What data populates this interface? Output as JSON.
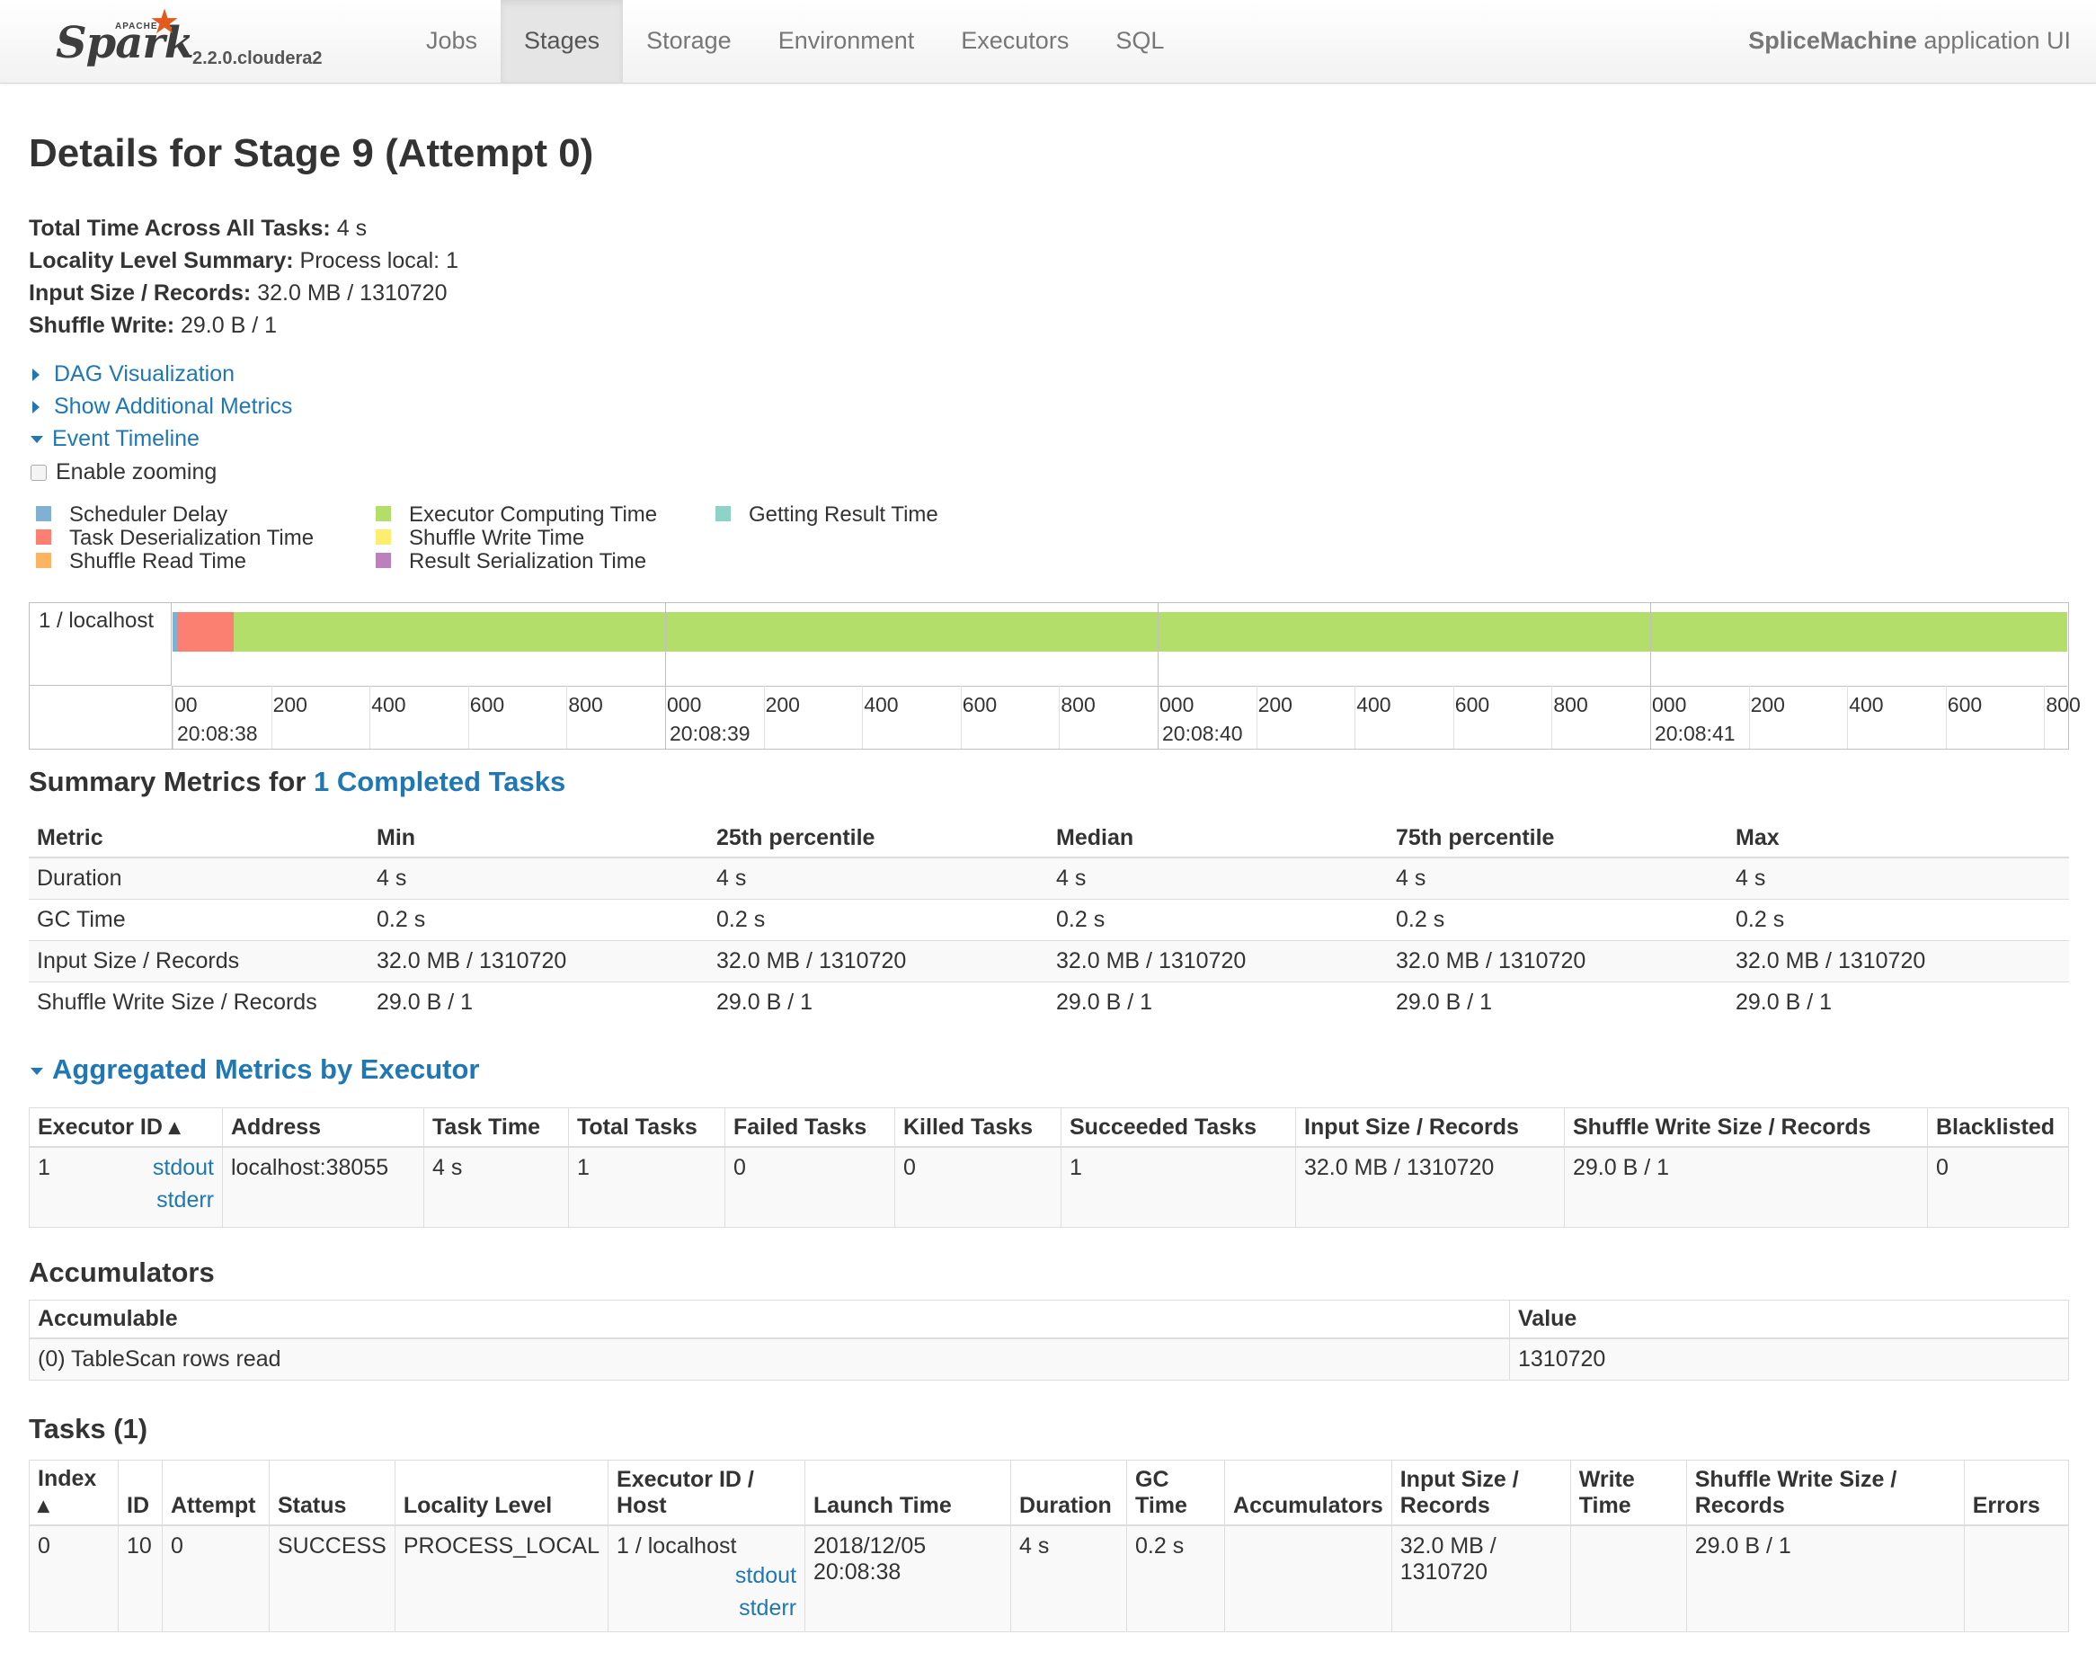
{
  "navbar": {
    "logo_apache": "APACHE",
    "logo_spark": "Spark",
    "version": "2.2.0.cloudera2",
    "tabs": [
      {
        "label": "Jobs",
        "active": false
      },
      {
        "label": "Stages",
        "active": true
      },
      {
        "label": "Storage",
        "active": false
      },
      {
        "label": "Environment",
        "active": false
      },
      {
        "label": "Executors",
        "active": false
      },
      {
        "label": "SQL",
        "active": false
      }
    ],
    "app_name": "SpliceMachine",
    "app_suffix": "application UI"
  },
  "page": {
    "title": "Details for Stage 9 (Attempt 0)",
    "summary": [
      {
        "label": "Total Time Across All Tasks:",
        "value": "4 s"
      },
      {
        "label": "Locality Level Summary:",
        "value": "Process local: 1"
      },
      {
        "label": "Input Size / Records:",
        "value": "32.0 MB / 1310720"
      },
      {
        "label": "Shuffle Write:",
        "value": "29.0 B / 1"
      }
    ],
    "toggles": {
      "dag": "DAG Visualization",
      "additional": "Show Additional Metrics",
      "timeline": "Event Timeline"
    },
    "enable_zooming": "Enable zooming"
  },
  "legend": [
    {
      "label": "Scheduler Delay",
      "color": "#80b1d3"
    },
    {
      "label": "Task Deserialization Time",
      "color": "#fb8072"
    },
    {
      "label": "Shuffle Read Time",
      "color": "#fdb462"
    },
    {
      "label": "Executor Computing Time",
      "color": "#b3de69"
    },
    {
      "label": "Shuffle Write Time",
      "color": "#ffed6f"
    },
    {
      "label": "Result Serialization Time",
      "color": "#bc80bd"
    },
    {
      "label": "Getting Result Time",
      "color": "#8dd3c7"
    }
  ],
  "timeline": {
    "row_label": "1 / localhost",
    "tick_labels": [
      "00",
      "200",
      "400",
      "600",
      "800",
      "000",
      "200",
      "400",
      "600",
      "800",
      "000",
      "200",
      "400",
      "600",
      "800",
      "000",
      "200",
      "400",
      "600",
      "800"
    ],
    "date_labels": [
      "20:08:38",
      "20:08:39",
      "20:08:40",
      "20:08:41"
    ]
  },
  "summary_metrics": {
    "title_prefix": "Summary Metrics for ",
    "title_link": "1 Completed Tasks",
    "headers": [
      "Metric",
      "Min",
      "25th percentile",
      "Median",
      "75th percentile",
      "Max"
    ],
    "rows": [
      [
        "Duration",
        "4 s",
        "4 s",
        "4 s",
        "4 s",
        "4 s"
      ],
      [
        "GC Time",
        "0.2 s",
        "0.2 s",
        "0.2 s",
        "0.2 s",
        "0.2 s"
      ],
      [
        "Input Size / Records",
        "32.0 MB / 1310720",
        "32.0 MB / 1310720",
        "32.0 MB / 1310720",
        "32.0 MB / 1310720",
        "32.0 MB / 1310720"
      ],
      [
        "Shuffle Write Size / Records",
        "29.0 B / 1",
        "29.0 B / 1",
        "29.0 B / 1",
        "29.0 B / 1",
        "29.0 B / 1"
      ]
    ]
  },
  "aggregated": {
    "title": "Aggregated Metrics by Executor",
    "headers": [
      "Executor ID ▴",
      "Address",
      "Task Time",
      "Total Tasks",
      "Failed Tasks",
      "Killed Tasks",
      "Succeeded Tasks",
      "Input Size / Records",
      "Shuffle Write Size / Records",
      "Blacklisted"
    ],
    "row": {
      "id": "1",
      "stdout": "stdout",
      "stderr": "stderr",
      "address": "localhost:38055",
      "task_time": "4 s",
      "total": "1",
      "failed": "0",
      "killed": "0",
      "succeeded": "1",
      "input": "32.0 MB / 1310720",
      "shuffle": "29.0 B / 1",
      "blacklisted": "0"
    }
  },
  "accumulators": {
    "title": "Accumulators",
    "headers": [
      "Accumulable",
      "Value"
    ],
    "row": [
      "(0) TableScan rows read",
      "1310720"
    ]
  },
  "tasks": {
    "title": "Tasks (1)",
    "headers": [
      "Index ▴",
      "ID",
      "Attempt",
      "Status",
      "Locality Level",
      "Executor ID / Host",
      "Launch Time",
      "Duration",
      "GC Time",
      "Accumulators",
      "Input Size / Records",
      "Write Time",
      "Shuffle Write Size / Records",
      "Errors"
    ],
    "row": {
      "index": "0",
      "id": "10",
      "attempt": "0",
      "status": "SUCCESS",
      "locality": "PROCESS_LOCAL",
      "host": "1 / localhost",
      "stdout": "stdout",
      "stderr": "stderr",
      "launch": "2018/12/05 20:08:38",
      "duration": "4 s",
      "gc": "0.2 s",
      "accumulators": "",
      "input": "32.0 MB / 1310720",
      "write_time": "",
      "shuffle": "29.0 B / 1",
      "errors": ""
    }
  }
}
